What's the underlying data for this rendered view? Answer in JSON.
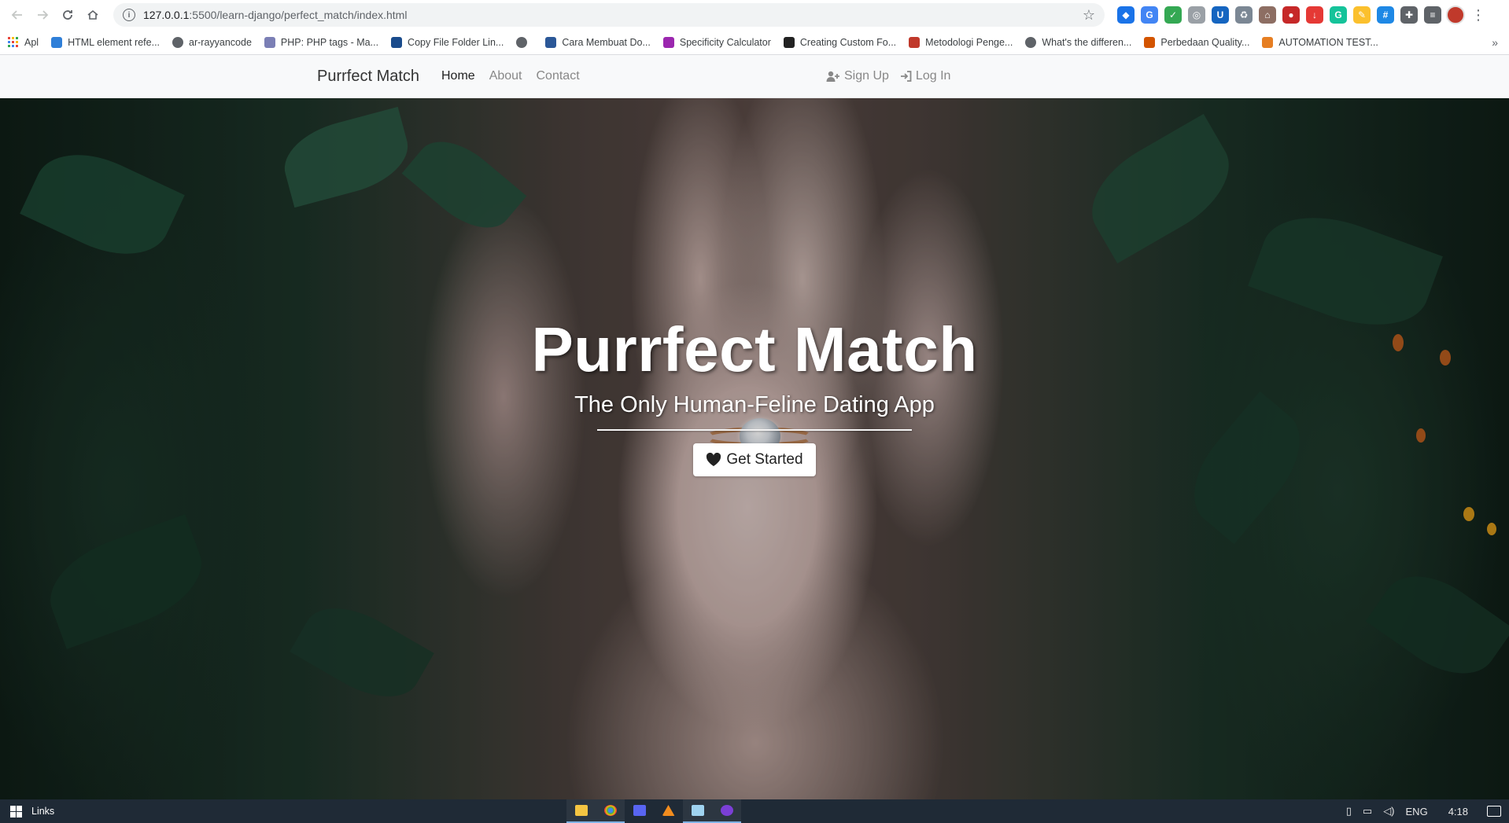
{
  "browser": {
    "url_host": "127.0.0.1",
    "url_path": ":5500/learn-django/perfect_match/index.html"
  },
  "bookmarks": {
    "apps_label": "Apl",
    "items": [
      {
        "label": "HTML element refe...",
        "icon": "w3schools-icon",
        "color": "#2f7fd8"
      },
      {
        "label": "ar-rayyancode",
        "icon": "globe-icon",
        "color": "#5f6368"
      },
      {
        "label": "PHP: PHP tags - Ma...",
        "icon": "php-icon",
        "color": "#7b7fb5"
      },
      {
        "label": "Copy File Folder Lin...",
        "icon": "amazon-icon",
        "color": "#1a4b8c"
      },
      {
        "label": "",
        "icon": "globe-icon",
        "color": "#5f6368"
      },
      {
        "label": "Cara Membuat Do...",
        "icon": "code-icon",
        "color": "#2b5797"
      },
      {
        "label": "Specificity Calculator",
        "icon": "dots-icon",
        "color": "#9b27af"
      },
      {
        "label": "Creating Custom Fo...",
        "icon": "ih-icon",
        "color": "#222222"
      },
      {
        "label": "Metodologi Penge...",
        "icon": "site-icon",
        "color": "#c0392b"
      },
      {
        "label": "What's the differen...",
        "icon": "globe-icon",
        "color": "#5f6368"
      },
      {
        "label": "Perbedaan Quality...",
        "icon": "site-icon",
        "color": "#d35400"
      },
      {
        "label": "AUTOMATION TEST...",
        "icon": "guru-icon",
        "color": "#e67e22"
      }
    ]
  },
  "site": {
    "brand": "Purrfect Match",
    "nav": [
      "Home",
      "About",
      "Contact"
    ],
    "signup": "Sign Up",
    "login": "Log In"
  },
  "hero": {
    "title": "Purrfect Match",
    "subtitle": "The Only Human-Feline Dating App",
    "cta": "Get Started"
  },
  "taskbar": {
    "links_label": "Links",
    "lang": "ENG",
    "time": "4:18"
  }
}
